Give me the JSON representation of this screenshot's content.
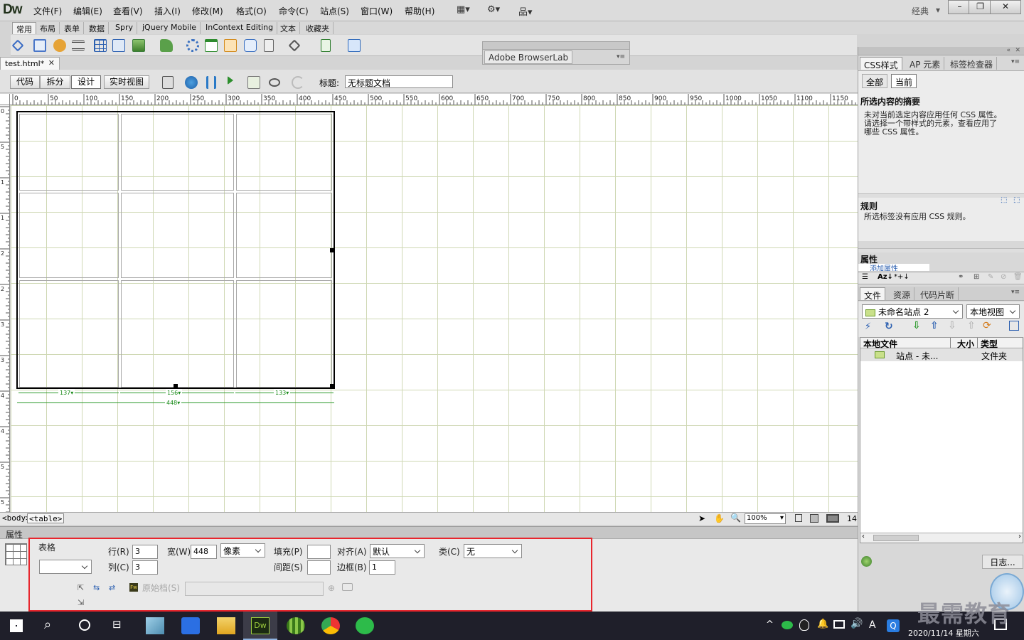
{
  "app": {
    "logo": "Dw",
    "workspace": "经典"
  },
  "menu": [
    "文件(F)",
    "编辑(E)",
    "查看(V)",
    "插入(I)",
    "修改(M)",
    "格式(O)",
    "命令(C)",
    "站点(S)",
    "窗口(W)",
    "帮助(H)"
  ],
  "window_controls": {
    "minimize": "–",
    "restore": "❐",
    "close": "✕"
  },
  "insert_tabs": [
    "常用",
    "布局",
    "表单",
    "数据",
    "Spry",
    "jQuery Mobile",
    "InContext Editing",
    "文本",
    "收藏夹"
  ],
  "browserlab": {
    "tab": "Adobe BrowserLab"
  },
  "document": {
    "tab": "test.html*",
    "close": "✕",
    "views": [
      "代码",
      "拆分",
      "设计",
      "实时视图"
    ],
    "title_label": "标题:",
    "title_value": "无标题文档"
  },
  "table_widths": {
    "col1": "137",
    "col2": "156",
    "col3": "133",
    "total": "448"
  },
  "ruler_labels": [
    "0",
    "50",
    "100",
    "150",
    "200",
    "250",
    "300",
    "350",
    "400",
    "450",
    "500",
    "550",
    "600",
    "650",
    "700",
    "750",
    "800",
    "850",
    "900",
    "950",
    "1000",
    "1050",
    "1100",
    "1150"
  ],
  "status": {
    "tag_body": "<body>",
    "tag_table": "<table>",
    "zoom": "100%",
    "dims": "14"
  },
  "properties": {
    "header": "属性",
    "type_label": "表格",
    "rows_label": "行(R)",
    "rows_value": "3",
    "cols_label": "列(C)",
    "cols_value": "3",
    "width_label": "宽(W)",
    "width_value": "448",
    "width_unit": "像素",
    "cellpad_label": "填充(P)",
    "cellpad_value": "",
    "cellspace_label": "间距(S)",
    "cellspace_value": "",
    "align_label": "对齐(A)",
    "align_value": "默认",
    "border_label": "边框(B)",
    "border_value": "1",
    "class_label": "类(C)",
    "class_value": "无",
    "table_id_value": "",
    "source_label": "原始档(S)",
    "source_value": ""
  },
  "css_panel": {
    "tabs": [
      "CSS样式",
      "AP 元素",
      "标签检查器"
    ],
    "modes": [
      "全部",
      "当前"
    ],
    "summary_title": "所选内容的摘要",
    "summary_text": [
      "未对当前选定内容应用任何 CSS 属性。",
      "请选择一个带样式的元素，查看应用了",
      "哪些 CSS 属性。"
    ],
    "rules_title": "规则",
    "rules_text": "所选标签没有应用 CSS 规则。",
    "props_title": "属性",
    "add_property": "添加属性"
  },
  "files_panel": {
    "tabs": [
      "文件",
      "资源",
      "代码片断"
    ],
    "site": "未命名站点 2",
    "view": "本地视图",
    "columns": [
      "本地文件",
      "大小",
      "类型"
    ],
    "row": {
      "name": "站点 - 未...",
      "type": "文件夹"
    },
    "log_button": "日志..."
  },
  "taskbar": {
    "date": "2020/11/14 星期六",
    "ime": "A"
  },
  "watermark": "最需教育",
  "colors": {
    "selection_outline": "#e8262d",
    "guide_green": "#2c9a2c",
    "grid": "#cfd8b4"
  }
}
